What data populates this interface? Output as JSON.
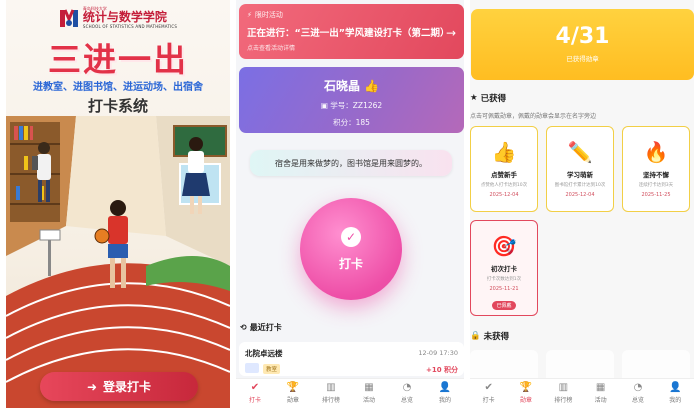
{
  "login": {
    "school_small": "青岛科技大学",
    "school_name": "统计与数学学院",
    "school_en": "SCHOOL OF STATISTICS AND MATHEMATICS",
    "title": "三进一出",
    "subtitle": "进教室、进图书馆、进运动场、出宿舍",
    "system": "打卡系统",
    "button": "登录打卡"
  },
  "checkin": {
    "activity_tag": "限时活动",
    "activity_title": "正在进行：“三进一出”学风建设打卡（第二期）",
    "activity_desc": "点击查看活动详情",
    "user_name": "石晓晶 👍",
    "student_id": "学号：ZZ1262",
    "points": "积分：185",
    "quote": "宿舍是用来做梦的，图书馆是用来圆梦的。",
    "button": "打卡",
    "recent_title": "最近打卡",
    "recent": {
      "place": "北院卓远楼",
      "time": "12-09 17:30",
      "tag": "教室",
      "points": "+10 积分"
    }
  },
  "tabs": [
    "打卡",
    "勋章",
    "排行榜",
    "活动",
    "总览",
    "我的"
  ],
  "badges": {
    "count": "4/31",
    "count_label": "已获得勋章",
    "earned_title": "已获得",
    "note": "点击可佩戴勋章，佩戴的勋章会显示在名字旁边",
    "items": [
      {
        "icon": "👍",
        "name": "点赞新手",
        "desc": "点赞他人打卡达到10次",
        "date": "2025-12-04"
      },
      {
        "icon": "✏️",
        "name": "学习萌新",
        "desc": "图书馆打卡累计达到10次",
        "date": "2025-12-04"
      },
      {
        "icon": "🔥",
        "name": "坚持不懈",
        "desc": "连续打卡达到3天",
        "date": "2025-11-25"
      },
      {
        "icon": "🎯",
        "name": "初次打卡",
        "desc": "打卡次数达到1次",
        "date": "2025-11-21",
        "worn": "已佩戴"
      }
    ],
    "unearned_title": "未获得"
  },
  "colors": {
    "primary": "#e2485d",
    "gold": "#ffbd21",
    "purple": "#7b6fe4",
    "pink": "#ee4fa7"
  }
}
